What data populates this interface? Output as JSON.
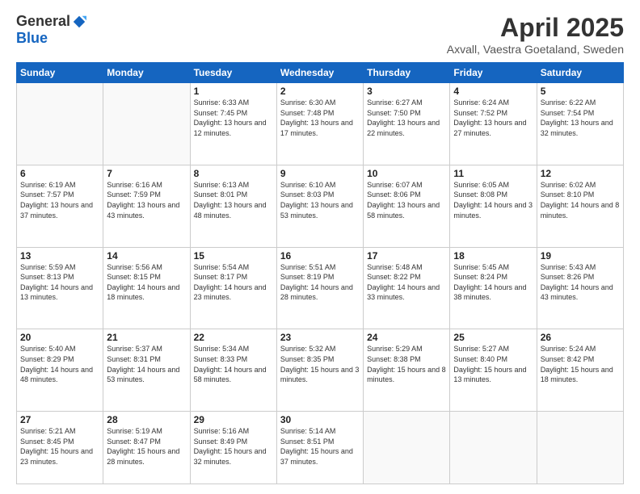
{
  "logo": {
    "general": "General",
    "blue": "Blue"
  },
  "title": "April 2025",
  "location": "Axvall, Vaestra Goetaland, Sweden",
  "days_of_week": [
    "Sunday",
    "Monday",
    "Tuesday",
    "Wednesday",
    "Thursday",
    "Friday",
    "Saturday"
  ],
  "weeks": [
    [
      {
        "day": "",
        "info": ""
      },
      {
        "day": "",
        "info": ""
      },
      {
        "day": "1",
        "info": "Sunrise: 6:33 AM\nSunset: 7:45 PM\nDaylight: 13 hours and 12 minutes."
      },
      {
        "day": "2",
        "info": "Sunrise: 6:30 AM\nSunset: 7:48 PM\nDaylight: 13 hours and 17 minutes."
      },
      {
        "day": "3",
        "info": "Sunrise: 6:27 AM\nSunset: 7:50 PM\nDaylight: 13 hours and 22 minutes."
      },
      {
        "day": "4",
        "info": "Sunrise: 6:24 AM\nSunset: 7:52 PM\nDaylight: 13 hours and 27 minutes."
      },
      {
        "day": "5",
        "info": "Sunrise: 6:22 AM\nSunset: 7:54 PM\nDaylight: 13 hours and 32 minutes."
      }
    ],
    [
      {
        "day": "6",
        "info": "Sunrise: 6:19 AM\nSunset: 7:57 PM\nDaylight: 13 hours and 37 minutes."
      },
      {
        "day": "7",
        "info": "Sunrise: 6:16 AM\nSunset: 7:59 PM\nDaylight: 13 hours and 43 minutes."
      },
      {
        "day": "8",
        "info": "Sunrise: 6:13 AM\nSunset: 8:01 PM\nDaylight: 13 hours and 48 minutes."
      },
      {
        "day": "9",
        "info": "Sunrise: 6:10 AM\nSunset: 8:03 PM\nDaylight: 13 hours and 53 minutes."
      },
      {
        "day": "10",
        "info": "Sunrise: 6:07 AM\nSunset: 8:06 PM\nDaylight: 13 hours and 58 minutes."
      },
      {
        "day": "11",
        "info": "Sunrise: 6:05 AM\nSunset: 8:08 PM\nDaylight: 14 hours and 3 minutes."
      },
      {
        "day": "12",
        "info": "Sunrise: 6:02 AM\nSunset: 8:10 PM\nDaylight: 14 hours and 8 minutes."
      }
    ],
    [
      {
        "day": "13",
        "info": "Sunrise: 5:59 AM\nSunset: 8:13 PM\nDaylight: 14 hours and 13 minutes."
      },
      {
        "day": "14",
        "info": "Sunrise: 5:56 AM\nSunset: 8:15 PM\nDaylight: 14 hours and 18 minutes."
      },
      {
        "day": "15",
        "info": "Sunrise: 5:54 AM\nSunset: 8:17 PM\nDaylight: 14 hours and 23 minutes."
      },
      {
        "day": "16",
        "info": "Sunrise: 5:51 AM\nSunset: 8:19 PM\nDaylight: 14 hours and 28 minutes."
      },
      {
        "day": "17",
        "info": "Sunrise: 5:48 AM\nSunset: 8:22 PM\nDaylight: 14 hours and 33 minutes."
      },
      {
        "day": "18",
        "info": "Sunrise: 5:45 AM\nSunset: 8:24 PM\nDaylight: 14 hours and 38 minutes."
      },
      {
        "day": "19",
        "info": "Sunrise: 5:43 AM\nSunset: 8:26 PM\nDaylight: 14 hours and 43 minutes."
      }
    ],
    [
      {
        "day": "20",
        "info": "Sunrise: 5:40 AM\nSunset: 8:29 PM\nDaylight: 14 hours and 48 minutes."
      },
      {
        "day": "21",
        "info": "Sunrise: 5:37 AM\nSunset: 8:31 PM\nDaylight: 14 hours and 53 minutes."
      },
      {
        "day": "22",
        "info": "Sunrise: 5:34 AM\nSunset: 8:33 PM\nDaylight: 14 hours and 58 minutes."
      },
      {
        "day": "23",
        "info": "Sunrise: 5:32 AM\nSunset: 8:35 PM\nDaylight: 15 hours and 3 minutes."
      },
      {
        "day": "24",
        "info": "Sunrise: 5:29 AM\nSunset: 8:38 PM\nDaylight: 15 hours and 8 minutes."
      },
      {
        "day": "25",
        "info": "Sunrise: 5:27 AM\nSunset: 8:40 PM\nDaylight: 15 hours and 13 minutes."
      },
      {
        "day": "26",
        "info": "Sunrise: 5:24 AM\nSunset: 8:42 PM\nDaylight: 15 hours and 18 minutes."
      }
    ],
    [
      {
        "day": "27",
        "info": "Sunrise: 5:21 AM\nSunset: 8:45 PM\nDaylight: 15 hours and 23 minutes."
      },
      {
        "day": "28",
        "info": "Sunrise: 5:19 AM\nSunset: 8:47 PM\nDaylight: 15 hours and 28 minutes."
      },
      {
        "day": "29",
        "info": "Sunrise: 5:16 AM\nSunset: 8:49 PM\nDaylight: 15 hours and 32 minutes."
      },
      {
        "day": "30",
        "info": "Sunrise: 5:14 AM\nSunset: 8:51 PM\nDaylight: 15 hours and 37 minutes."
      },
      {
        "day": "",
        "info": ""
      },
      {
        "day": "",
        "info": ""
      },
      {
        "day": "",
        "info": ""
      }
    ]
  ]
}
